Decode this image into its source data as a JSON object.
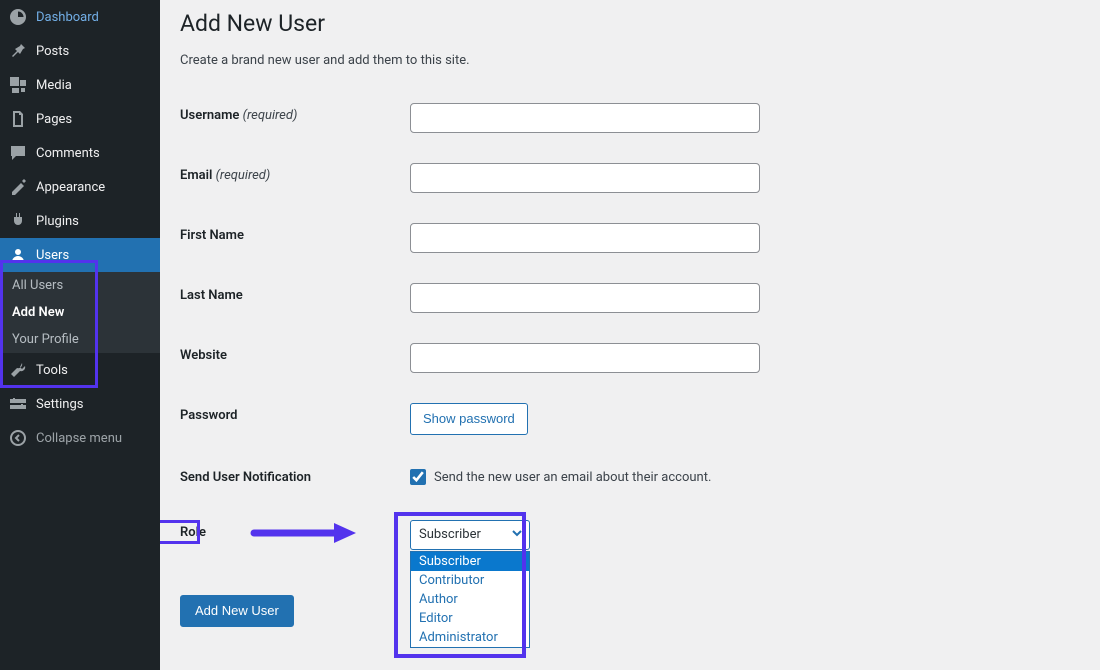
{
  "sidebar": {
    "items": [
      {
        "label": "Dashboard",
        "icon": "dashboard"
      },
      {
        "label": "Posts",
        "icon": "pin"
      },
      {
        "label": "Media",
        "icon": "media"
      },
      {
        "label": "Pages",
        "icon": "pages"
      },
      {
        "label": "Comments",
        "icon": "comments"
      },
      {
        "label": "Appearance",
        "icon": "appearance"
      },
      {
        "label": "Plugins",
        "icon": "plugins"
      },
      {
        "label": "Users",
        "icon": "users",
        "active": true
      },
      {
        "label": "Tools",
        "icon": "tools"
      },
      {
        "label": "Settings",
        "icon": "settings"
      }
    ],
    "submenu": [
      {
        "label": "All Users"
      },
      {
        "label": "Add New",
        "current": true
      },
      {
        "label": "Your Profile"
      }
    ],
    "collapse_label": "Collapse menu"
  },
  "page": {
    "title": "Add New User",
    "subtitle": "Create a brand new user and add them to this site.",
    "fields": {
      "username": {
        "label": "Username",
        "required_text": "(required)",
        "value": ""
      },
      "email": {
        "label": "Email",
        "required_text": "(required)",
        "value": ""
      },
      "first_name": {
        "label": "First Name",
        "value": ""
      },
      "last_name": {
        "label": "Last Name",
        "value": ""
      },
      "website": {
        "label": "Website",
        "value": ""
      },
      "password": {
        "label": "Password",
        "button_label": "Show password"
      },
      "notification": {
        "label": "Send User Notification",
        "checkbox_label": "Send the new user an email about their account.",
        "checked": true
      },
      "role": {
        "label": "Role",
        "selected": "Subscriber",
        "options": [
          "Subscriber",
          "Contributor",
          "Author",
          "Editor",
          "Administrator"
        ]
      }
    },
    "submit_label": "Add New User"
  }
}
